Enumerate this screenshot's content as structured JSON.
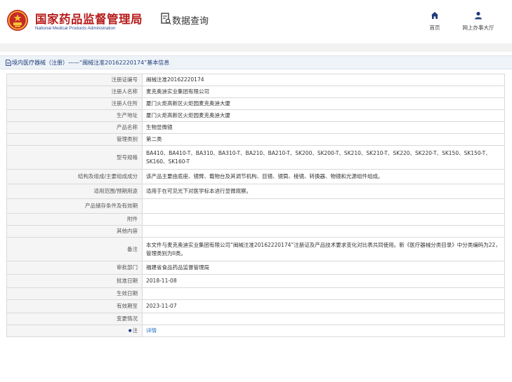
{
  "header": {
    "logo_cn": "国家药品监督管理局",
    "logo_en": "National Medical Products Administration",
    "query_title": "数据查询",
    "nav": [
      {
        "label": "首页",
        "icon": "home-icon"
      },
      {
        "label": "网上办事大厅",
        "icon": "user-icon"
      }
    ]
  },
  "breadcrumb": {
    "icon": "document-icon",
    "text": "境内医疗器械（注册）——“闽械注准20162220174”基本信息"
  },
  "colors": {
    "brand_red": "#b71c1c",
    "brand_blue": "#2e4d96",
    "nav_blue": "#1f3d7a",
    "link_blue": "#1f6fc5"
  },
  "details": {
    "rows": [
      {
        "label": "注册证编号",
        "value": "闽械注准20162220174"
      },
      {
        "label": "注册人名称",
        "value": "麦克奥迪实业集团有限公司"
      },
      {
        "label": "注册人住所",
        "value": "厦门火炬高新区火炬园麦克奥迪大厦"
      },
      {
        "label": "生产地址",
        "value": "厦门火炬高新区火炬园麦克奥迪大厦"
      },
      {
        "label": "产品名称",
        "value": "生物显微镜"
      },
      {
        "label": "管理类别",
        "value": "第二类"
      },
      {
        "label": "型号规格",
        "value": "BA410、BA410-T、BA310、BA310-T、BA210、BA210-T、SK200、SK200-T、SK210、SK210-T、SK220、SK220-T、SK150、SK150-T、SK160、SK160-T"
      },
      {
        "label": "结构及组成/主要组成成分",
        "value": "该产品主要由底座、镜臂、载物台及其调节机构、目镜、镜筒、棱镜、转换器、物镜和光源组件组成。"
      },
      {
        "label": "适用范围/预期用途",
        "value": "适用于在可见光下对医学标本进行显微观察。"
      },
      {
        "label": "产品储存条件及有效期",
        "value": ""
      },
      {
        "label": "附件",
        "value": ""
      },
      {
        "label": "其他内容",
        "value": ""
      },
      {
        "label": "备注",
        "value": "本文件与麦克奥迪实业集团有限公司“闽械注准20162220174”注册证及产品技术要求变化对比表共同使用。新《医疗器械分类目录》中分类编码为22，管理类别为II类。"
      },
      {
        "label": "审批部门",
        "value": "福建省食品药品监督管理局"
      },
      {
        "label": "批准日期",
        "value": "2018-11-08"
      },
      {
        "label": "生效日期",
        "value": ""
      },
      {
        "label": "有效期至",
        "value": "2023-11-07"
      },
      {
        "label": "变更情况",
        "value": ""
      }
    ],
    "note_row": {
      "label": "注",
      "star": "●",
      "link": "详情"
    }
  }
}
